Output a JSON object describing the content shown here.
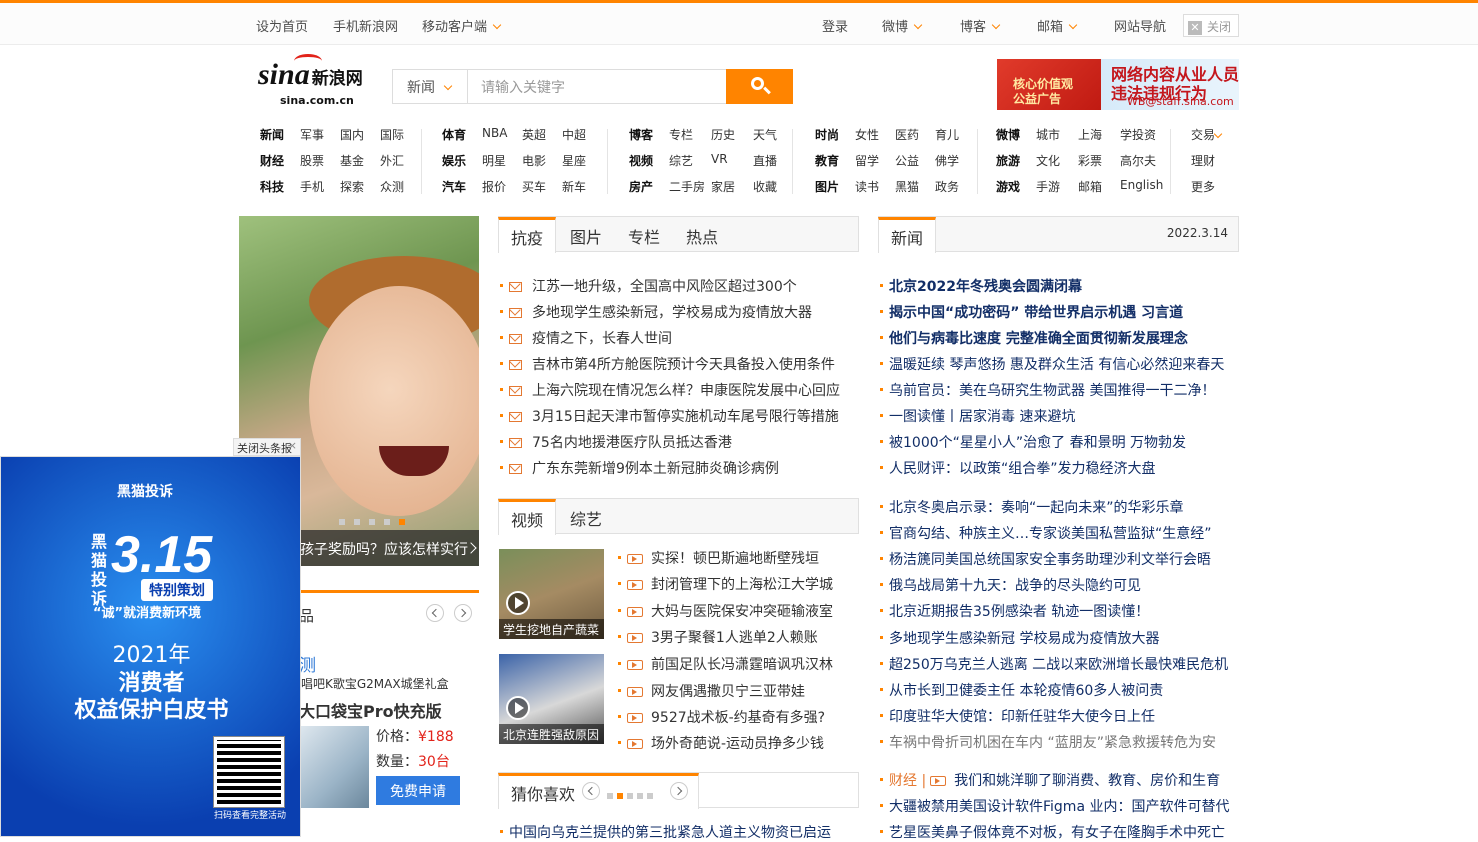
{
  "topbar": {
    "left": [
      "设为首页",
      "手机新浪网",
      "移动客户端"
    ],
    "right": [
      "登录",
      "微博",
      "博客",
      "邮箱",
      "网站导航"
    ],
    "close": "关闭"
  },
  "logo": {
    "brand": "sina",
    "cn": "新浪网",
    "domain": "sina.com.cn"
  },
  "search": {
    "category": "新闻",
    "placeholder": "请输入关键字"
  },
  "ad": {
    "tag1": "核心价值观",
    "tag2": "公益广告",
    "line1": "网络内容从业人员",
    "line2": "违法违规行为",
    "email": "WB@staff.sina.com"
  },
  "nav": [
    [
      [
        "新闻",
        "军事",
        "国内",
        "国际"
      ],
      [
        "财经",
        "股票",
        "基金",
        "外汇"
      ],
      [
        "科技",
        "手机",
        "探索",
        "众测"
      ]
    ],
    [
      [
        "体育",
        "NBA",
        "英超",
        "中超"
      ],
      [
        "娱乐",
        "明星",
        "电影",
        "星座"
      ],
      [
        "汽车",
        "报价",
        "买车",
        "新车"
      ]
    ],
    [
      [
        "博客",
        "专栏",
        "历史",
        "天气"
      ],
      [
        "视频",
        "综艺",
        "VR",
        "直播"
      ],
      [
        "房产",
        "二手房",
        "家居",
        "收藏"
      ]
    ],
    [
      [
        "时尚",
        "女性",
        "医药",
        "育儿"
      ],
      [
        "教育",
        "留学",
        "公益",
        "佛学"
      ],
      [
        "图片",
        "读书",
        "黑猫",
        "政务"
      ]
    ],
    [
      [
        "微博",
        "城市",
        "上海",
        "学投资"
      ],
      [
        "旅游",
        "文化",
        "彩票",
        "高尔夫"
      ],
      [
        "游戏",
        "手游",
        "邮箱",
        "English"
      ]
    ],
    [
      [
        "交易"
      ],
      [
        "理财"
      ],
      [
        "更多"
      ]
    ]
  ],
  "slide": {
    "caption": "孩子奖励吗？应该怎样实行"
  },
  "float_ad": {
    "close": "关闭头条报",
    "brand": "黑猫投诉",
    "side": "黑猫投诉",
    "big": "3.15",
    "tag": "特别策划",
    "slogan": "“诚”就消费新环境",
    "year": "2021年",
    "title1": "消费者",
    "title2": "权益保护白皮书",
    "qr_text": "扫码查看完整活动"
  },
  "product": {
    "title": "品",
    "ce": "测",
    "p1": "唱吧K歌宝G2MAX城堡礼盒",
    "p2": "大口袋宝Pro快充版",
    "price_label": "价格：",
    "price": "¥188",
    "qty_label": "数量：",
    "qty": "30台",
    "apply": "免费申请"
  },
  "tabs1": [
    "抗疫",
    "图片",
    "专栏",
    "热点"
  ],
  "list1": [
    "江苏一地升级，全国高中风险区超过300个",
    "多地现学生感染新冠，学校易成为疫情放大器",
    "疫情之下，长春人世间",
    "吉林市第4所方舱医院预计今天具备投入使用条件",
    "上海六院现在情况怎么样？申康医院发展中心回应",
    "3月15日起天津市暂停实施机动车尾号限行等措施",
    "75名内地援港医疗队员抵达香港",
    "广东东莞新增9例本土新冠肺炎确诊病例"
  ],
  "tabs2": [
    "视频",
    "综艺"
  ],
  "videos": [
    {
      "caption": "学生挖地自产蔬菜"
    },
    {
      "caption": "北京连胜强敌原因"
    }
  ],
  "list2": [
    "实探！顿巴斯遍地断壁残垣",
    "封闭管理下的上海松江大学城",
    "大妈与医院保安冲突砸输液室",
    "3男子聚餐1人逃单2人赖账",
    "前国足队长冯潇霆暗讽巩汉林",
    "网友偶遇撒贝宁三亚带娃",
    "9527战术板-约基奇有多强?",
    "场外奇葩说-运动员挣多少钱"
  ],
  "guess": {
    "title": "猜你喜欢",
    "item": "中国向乌克兰提供的第三批紧急人道主义物资已启运"
  },
  "news": {
    "tab": "新闻",
    "date": "2022.3.14",
    "bold": [
      "北京2022年冬残奥会圆满闭幕",
      "揭示中国“成功密码” 带给世界启示机遇 习言道",
      "他们与病毒比速度 完整准确全面贯彻新发展理念"
    ],
    "items1": [
      "温暖延续 琴声悠扬 惠及群众生活 有信心必然迎来春天",
      "乌前官员：美在乌研究生物武器 美国推得一干二净！",
      "一图读懂丨居家消毒 速来避坑",
      "被1000个“星星小人”治愈了 春和景明 万物勃发",
      "人民财评：以政策“组合拳”发力稳经济大盘"
    ],
    "items2": [
      "北京冬奥启示录：奏响“一起向未来”的华彩乐章",
      "官商勾结、种族主义…专家谈美国私营监狱“生意经”",
      "杨洁篪同美国总统国家安全事务助理沙利文举行会晤",
      "俄乌战局第十九天：战争的尽头隐约可见",
      "北京近期报告35例感染者 轨迹一图读懂！",
      "多地现学生感染新冠 学校易成为疫情放大器",
      "超250万乌克兰人逃离 二战以来欧洲增长最快难民危机",
      "从市长到卫健委主任 本轮疫情60多人被问责",
      "印度驻华大使馆：印新任驻华大使今日上任",
      "车祸中骨折司机困在车内 “蓝朋友”紧急救援转危为安"
    ],
    "finance_label": "财经 |",
    "finance": "我们和姚洋聊了聊消费、教育、房价和生育",
    "items3": [
      "大疆被禁用美国设计软件Figma 业内：国产软件可替代",
      "艺星医美鼻子假体竟不对板，有女子在隆胸手术中死亡"
    ]
  }
}
